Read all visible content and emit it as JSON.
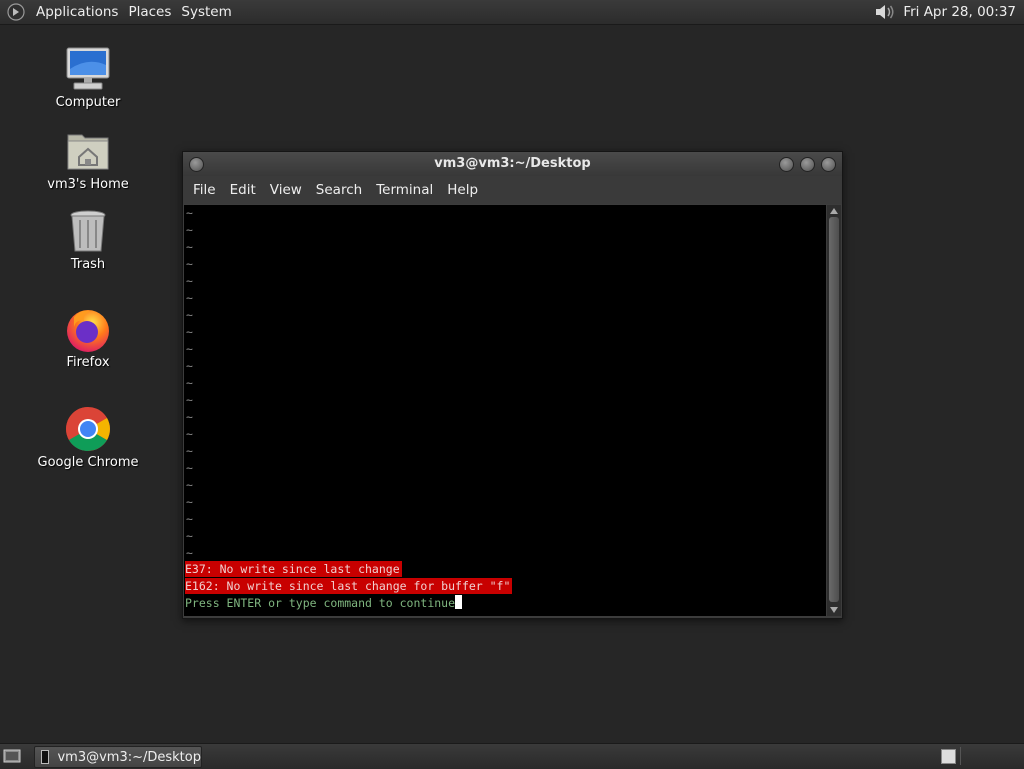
{
  "top_panel": {
    "menus": [
      "Applications",
      "Places",
      "System"
    ],
    "clock": "Fri Apr 28, 00:37"
  },
  "desktop_icons": [
    {
      "label": "Computer"
    },
    {
      "label": "vm3's Home"
    },
    {
      "label": "Trash"
    },
    {
      "label": "Firefox"
    },
    {
      "label": "Google Chrome"
    }
  ],
  "terminal": {
    "title": "vm3@vm3:~/Desktop",
    "menus": [
      "File",
      "Edit",
      "View",
      "Search",
      "Terminal",
      "Help"
    ],
    "tilde": "~",
    "error1": "E37: No write since last change",
    "error2": "E162: No write since last change for buffer \"f\"",
    "prompt": "Press ENTER or type command to continue",
    "colors": {
      "error_bg": "#c80000",
      "prompt_fg": "#7fb57f"
    }
  },
  "taskbar": {
    "task_label": "vm3@vm3:~/Desktop"
  }
}
